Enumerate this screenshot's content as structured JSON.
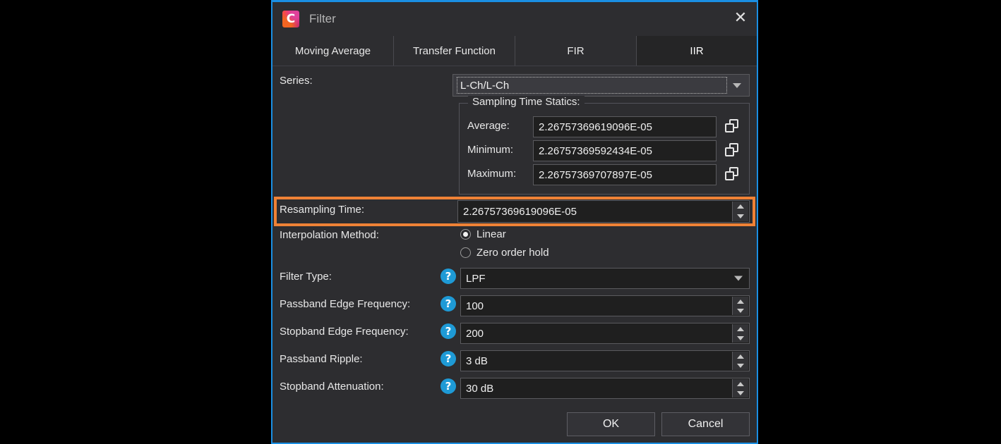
{
  "window": {
    "title": "Filter",
    "app_icon": "app-logo-icon",
    "close_label": "✕",
    "border_color": "#1a8fe3"
  },
  "tabs": [
    {
      "label": "Moving Average",
      "active": false
    },
    {
      "label": "Transfer Function",
      "active": false
    },
    {
      "label": "FIR",
      "active": false
    },
    {
      "label": "IIR",
      "active": true
    }
  ],
  "series": {
    "label": "Series:",
    "value": "L-Ch/L-Ch"
  },
  "sampling_stats": {
    "legend": "Sampling Time Statics:",
    "rows": [
      {
        "label": "Average:",
        "value": "2.26757369619096E-05",
        "copy_icon": "copy-icon"
      },
      {
        "label": "Minimum:",
        "value": "2.26757369592434E-05",
        "copy_icon": "copy-icon"
      },
      {
        "label": "Maximum:",
        "value": "2.26757369707897E-05",
        "copy_icon": "copy-icon"
      }
    ]
  },
  "resampling": {
    "label": "Resampling Time:",
    "value": "2.26757369619096E-05",
    "highlight_color": "#ef8236"
  },
  "interpolation": {
    "label": "Interpolation Method:",
    "options": [
      {
        "label": "Linear",
        "selected": true
      },
      {
        "label": "Zero order hold",
        "selected": false
      }
    ]
  },
  "fields": [
    {
      "label": "Filter Type:",
      "value": "LPF",
      "control": "combo",
      "help": "?"
    },
    {
      "label": "Passband Edge Frequency:",
      "value": "100",
      "control": "spinner",
      "help": "?"
    },
    {
      "label": "Stopband Edge Frequency:",
      "value": "200",
      "control": "spinner",
      "help": "?"
    },
    {
      "label": "Passband Ripple:",
      "value": "3 dB",
      "control": "spinner",
      "help": "?"
    },
    {
      "label": "Stopband Attenuation:",
      "value": "30 dB",
      "control": "spinner",
      "help": "?"
    }
  ],
  "footer": {
    "ok_label": "OK",
    "cancel_label": "Cancel"
  }
}
